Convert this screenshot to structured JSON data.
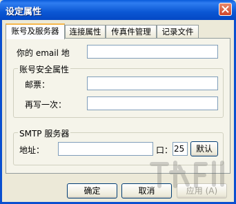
{
  "window": {
    "title": "设定属性"
  },
  "tabs": [
    {
      "label": "账号及服务器",
      "active": true
    },
    {
      "label": "连接属性",
      "active": false
    },
    {
      "label": "传真件管理",
      "active": false
    },
    {
      "label": "记录文件",
      "active": false
    }
  ],
  "account": {
    "email_label": "你的 email 地",
    "email_value": ""
  },
  "security_group": {
    "legend": "账号安全属性",
    "password_label": "邮票：",
    "password_value": "",
    "confirm_label": "再写一次：",
    "confirm_value": ""
  },
  "smtp_group": {
    "legend": "SMTP 服务器",
    "address_label": "地址：",
    "address_value": "",
    "port_label": "口：",
    "port_value": "25",
    "default_label": "默认"
  },
  "buttons": {
    "ok": "确定",
    "cancel": "取消",
    "apply": "应用 (A)"
  },
  "icons": {
    "close": "close-icon"
  }
}
